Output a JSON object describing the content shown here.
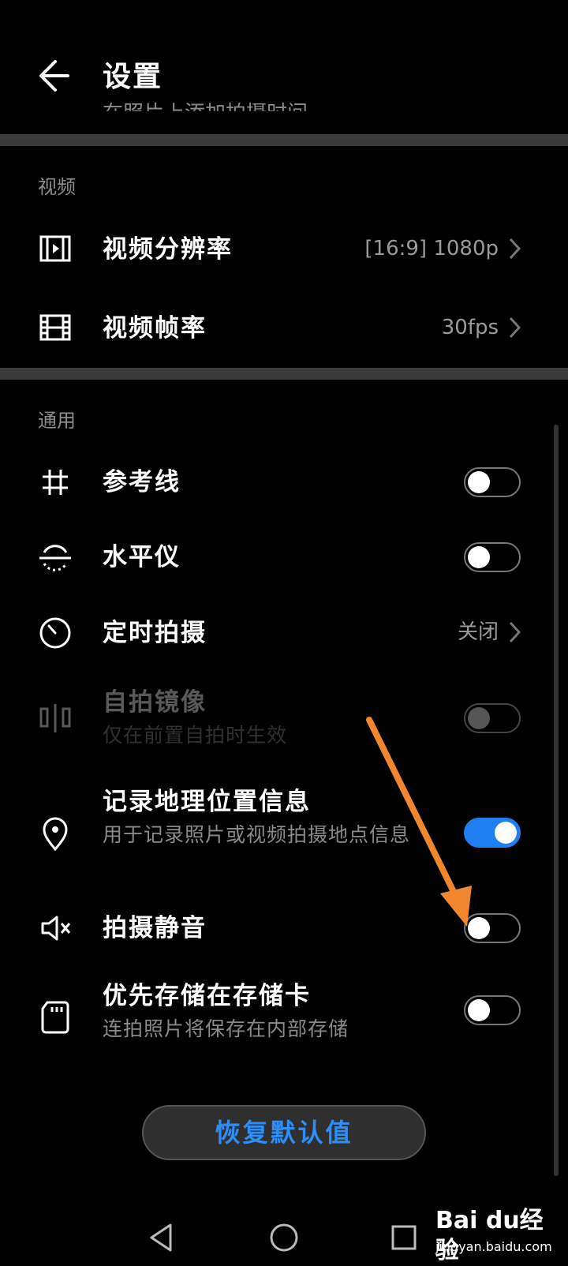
{
  "header": {
    "title": "设置",
    "peek_text": "在照片上添加拍摄时间"
  },
  "sections": {
    "video": {
      "label": "视频",
      "resolution": {
        "title": "视频分辨率",
        "value": "[16:9] 1080p"
      },
      "framerate": {
        "title": "视频帧率",
        "value": "30fps"
      }
    },
    "general": {
      "label": "通用",
      "gridlines": {
        "title": "参考线",
        "on": false
      },
      "level": {
        "title": "水平仪",
        "on": false
      },
      "timer": {
        "title": "定时拍摄",
        "value": "关闭"
      },
      "mirror": {
        "title": "自拍镜像",
        "subtitle": "仅在前置自拍时生效",
        "on": false,
        "disabled": true
      },
      "location": {
        "title": "记录地理位置信息",
        "subtitle": "用于记录照片或视频拍摄地点信息",
        "on": true
      },
      "mute": {
        "title": "拍摄静音",
        "on": false
      },
      "sdcard": {
        "title": "优先存储在存储卡",
        "subtitle": "连拍照片将保存在内部存储",
        "on": false
      }
    }
  },
  "restore_button": "恢复默认值",
  "watermark": {
    "brand": "Bai du经验",
    "site": "jingyan.baidu.com"
  },
  "colors": {
    "accent": "#1f7ff0",
    "button_text": "#2f8ef5",
    "arrow": "#f0862e"
  }
}
